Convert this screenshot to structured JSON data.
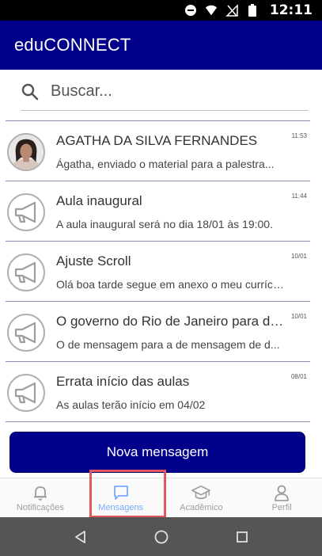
{
  "status_bar": {
    "time": "12:11"
  },
  "app": {
    "title": "eduCONNECT"
  },
  "search": {
    "placeholder": "Buscar..."
  },
  "messages": [
    {
      "name": "AGATHA DA SILVA FERNANDES",
      "preview": "Ágatha, enviado o material para a palestra...",
      "time": "11:53",
      "avatar": "photo"
    },
    {
      "name": "Aula inaugural",
      "preview": "A aula inaugural será no dia  18/01 às 19:00.",
      "time": "11:44",
      "avatar": "megaphone-icon"
    },
    {
      "name": "Ajuste Scroll",
      "preview": "Olá boa tarde segue em anexo o meu currículo...",
      "time": "10/01",
      "avatar": "megaphone-icon"
    },
    {
      "name": "O governo do Rio de Janeiro para de...",
      "preview": "O de mensagem para a de mensagem de d...",
      "time": "10/01",
      "avatar": "megaphone-icon"
    },
    {
      "name": "Errata início das aulas",
      "preview": "As aulas terão início em 04/02",
      "time": "08/01",
      "avatar": "megaphone-icon"
    }
  ],
  "new_message_button": "Nova mensagem",
  "bottom_nav": [
    {
      "label": "Notificações",
      "icon": "bell-icon",
      "active": false
    },
    {
      "label": "Mensagens",
      "icon": "chat-icon",
      "active": true
    },
    {
      "label": "Acadêmico",
      "icon": "graduation-cap-icon",
      "active": false
    },
    {
      "label": "Perfil",
      "icon": "person-icon",
      "active": false
    }
  ],
  "colors": {
    "primary": "#00008a",
    "active_nav": "#78a9ff",
    "highlight": "#e2575c"
  }
}
